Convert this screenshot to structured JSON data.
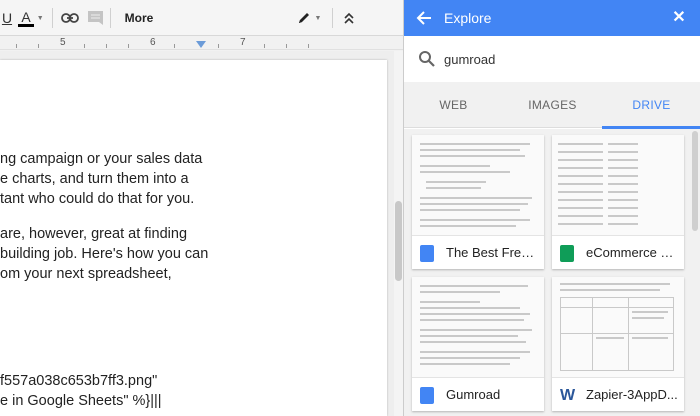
{
  "toolbar": {
    "underline_label": "U",
    "text_color_label": "A",
    "more_label": "More",
    "pen_icon": "pen-icon",
    "collapse_icon": "collapse-chevrons-icon"
  },
  "ruler": {
    "num_5": "5",
    "num_6": "6",
    "num_7": "7"
  },
  "document": {
    "lines": [
      "ng campaign or your sales data",
      "e charts, and turn them into a",
      "tant who could do that for you.",
      "are, however, great at finding",
      "building job. Here's how you can",
      "om your next spreadsheet,",
      "f557a038c653b7ff3.png\"",
      "e in Google Sheets\" %}|||"
    ]
  },
  "explore": {
    "title": "Explore",
    "search_value": "gumroad",
    "tabs": [
      "WEB",
      "IMAGES",
      "DRIVE"
    ],
    "active_tab": "DRIVE",
    "accent_color": "#4285f4",
    "results": [
      {
        "title": "The Best Free ...",
        "type": "docs"
      },
      {
        "title": "eCommerce O...",
        "type": "sheets"
      },
      {
        "title": "Gumroad",
        "type": "docs"
      },
      {
        "title": "Zapier-3AppD...",
        "type": "word"
      }
    ]
  }
}
